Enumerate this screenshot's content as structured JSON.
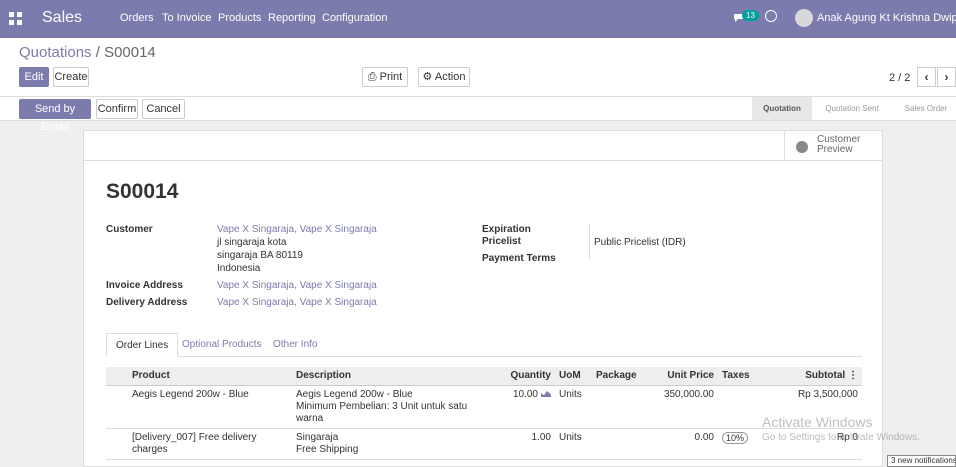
{
  "nav": {
    "app": "Sales",
    "menu": [
      "Orders",
      "To Invoice",
      "Products",
      "Reporting",
      "Configuration"
    ],
    "chat_count": "13",
    "user": "Anak Agung Kt Krishna Dwipayana"
  },
  "breadcrumb": {
    "parent": "Quotations",
    "current": "S00014"
  },
  "toolbar": {
    "edit": "Edit",
    "create": "Create",
    "print": "Print",
    "action": "Action",
    "pager": "2 / 2"
  },
  "actions": {
    "send_email": "Send by Email",
    "confirm": "Confirm",
    "cancel": "Cancel"
  },
  "stages": [
    "Quotation",
    "Quotation Sent",
    "Sales Order"
  ],
  "preview": {
    "line1": "Customer",
    "line2": "Preview"
  },
  "order": {
    "name": "S00014",
    "customer_label": "Customer",
    "customer_name": "Vape X Singaraja, Vape X Singaraja",
    "customer_addr1": "jl singaraja kota",
    "customer_addr2": "singaraja BA 80119",
    "customer_addr3": "Indonesia",
    "invoice_label": "Invoice Address",
    "invoice_value": "Vape X Singaraja, Vape X Singaraja",
    "delivery_label": "Delivery Address",
    "delivery_value": "Vape X Singaraja, Vape X Singaraja",
    "expiration_label": "Expiration",
    "pricelist_label": "Pricelist",
    "pricelist_value": "Public Pricelist (IDR)",
    "payment_label": "Payment Terms"
  },
  "tabs": [
    "Order Lines",
    "Optional Products",
    "Other Info"
  ],
  "lines": {
    "headers": [
      "Product",
      "Description",
      "Quantity",
      "UoM",
      "Package",
      "Unit Price",
      "Taxes",
      "Subtotal"
    ],
    "rows": [
      {
        "product": "Aegis Legend 200w - Blue",
        "desc1": "Aegis Legend 200w - Blue",
        "desc2": "Minimum Pembelian: 3 Unit untuk satu warna",
        "qty": "10.00",
        "uom": "Units",
        "package": "",
        "price": "350,000.00",
        "taxes": "",
        "subtotal": "Rp 3,500,000"
      },
      {
        "product": "[Delivery_007] Free delivery charges",
        "desc1": "Singaraja",
        "desc2": "Free Shipping",
        "qty": "1.00",
        "uom": "Units",
        "package": "",
        "price": "0.00",
        "taxes": "10%",
        "subtotal": "Rp 0"
      }
    ]
  },
  "overlay": {
    "wm1": "Activate Windows",
    "wm2": "Go to Settings to activate Windows.",
    "notif": "3 new notifications"
  }
}
